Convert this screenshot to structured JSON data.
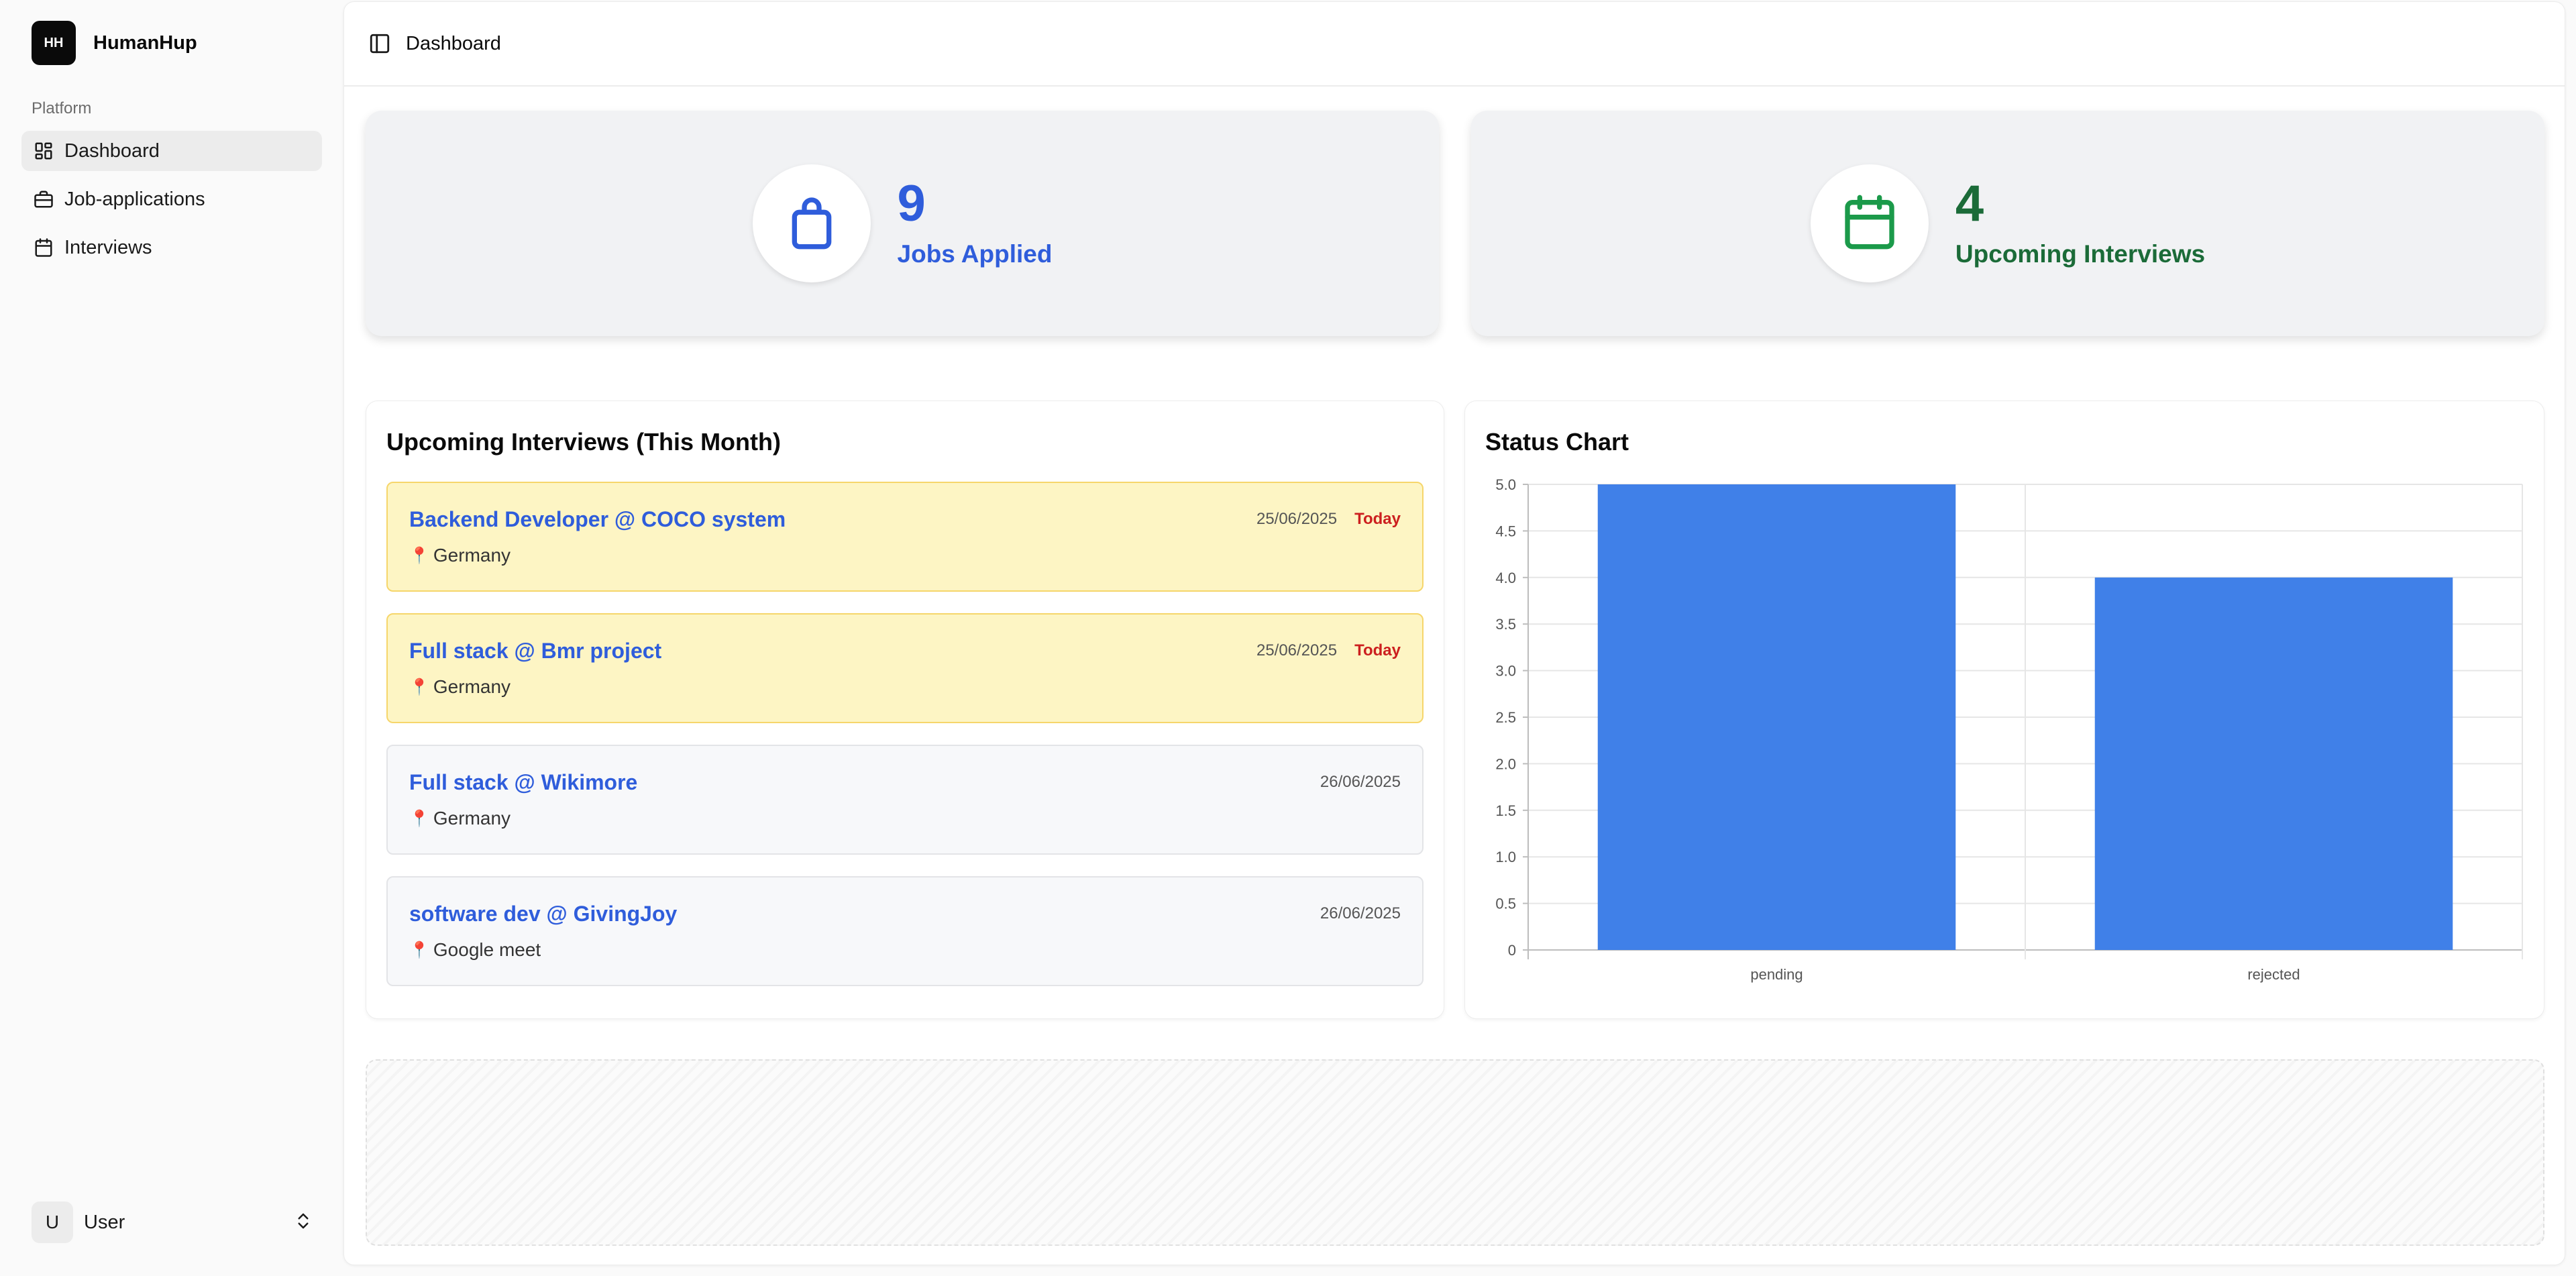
{
  "sidebar": {
    "brand": {
      "logo": "HH",
      "name": "HumanHup"
    },
    "group_label": "Platform",
    "items": [
      {
        "label": "Dashboard",
        "icon": "layout-grid-icon",
        "active": true
      },
      {
        "label": "Job-applications",
        "icon": "briefcase-icon",
        "active": false
      },
      {
        "label": "Interviews",
        "icon": "calendar-icon",
        "active": false
      }
    ],
    "user": {
      "initial": "U",
      "name": "User"
    }
  },
  "header": {
    "breadcrumb": "Dashboard"
  },
  "stats": {
    "jobs_applied": {
      "value": "9",
      "label": "Jobs Applied",
      "color": "#2f5ddb",
      "icon": "shopping-bag-icon"
    },
    "upcoming_interviews": {
      "value": "4",
      "label": "Upcoming Interviews",
      "color": "#1b6b38",
      "icon": "calendar-icon"
    }
  },
  "interviews": {
    "title": "Upcoming Interviews (This Month)",
    "items": [
      {
        "title": "Backend Developer @ COCO system",
        "location": "Germany",
        "date": "25/06/2025",
        "badge": "Today"
      },
      {
        "title": "Full stack @ Bmr project",
        "location": "Germany",
        "date": "25/06/2025",
        "badge": "Today"
      },
      {
        "title": "Full stack @ Wikimore",
        "location": "Germany",
        "date": "26/06/2025",
        "badge": ""
      },
      {
        "title": "software dev @ GivingJoy",
        "location": "Google meet",
        "date": "26/06/2025",
        "badge": ""
      }
    ]
  },
  "status_chart": {
    "title": "Status Chart"
  },
  "chart_data": {
    "type": "bar",
    "title": "Status Chart",
    "categories": [
      "pending",
      "rejected"
    ],
    "values": [
      5,
      4
    ],
    "ylim": [
      0,
      5
    ],
    "yticks": [
      "0",
      "0.5",
      "1.0",
      "1.5",
      "2.0",
      "2.5",
      "3.0",
      "3.5",
      "4.0",
      "4.5",
      "5.0"
    ],
    "grid": true,
    "bar_color": "#4080e8"
  }
}
